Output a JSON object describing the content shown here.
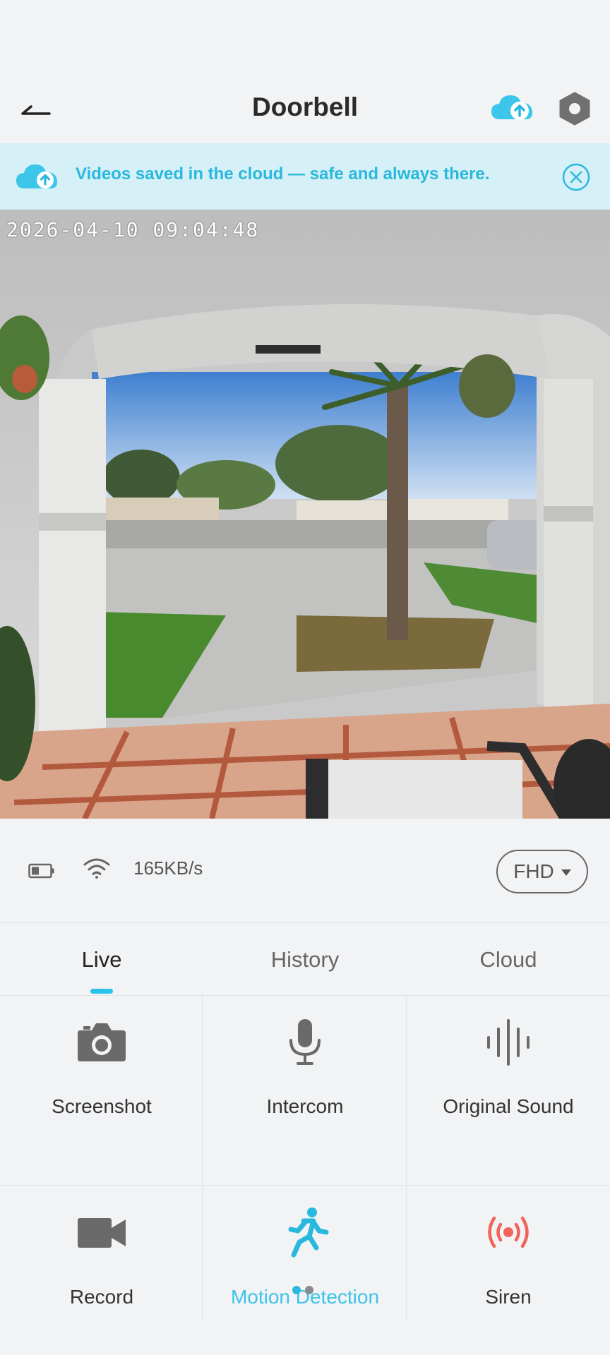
{
  "header": {
    "title": "Doorbell",
    "back_icon": "back-arrow-icon",
    "cloud_icon": "cloud-upload-icon",
    "settings_icon": "hexagon-settings-icon"
  },
  "banner": {
    "text": "Videos saved in the cloud — safe and always there.",
    "icon": "cloud-upload-icon",
    "close_icon": "close-circle-icon"
  },
  "video": {
    "timestamp": "2026-04-10  09:04:48"
  },
  "status": {
    "battery_icon": "battery-icon",
    "wifi_icon": "wifi-icon",
    "speed": "165KB/s",
    "quality": "FHD"
  },
  "tabs": [
    {
      "label": "Live",
      "active": true
    },
    {
      "label": "History",
      "active": false
    },
    {
      "label": "Cloud",
      "active": false
    }
  ],
  "controls": [
    {
      "label": "Screenshot",
      "icon": "camera-icon"
    },
    {
      "label": "Intercom",
      "icon": "microphone-icon"
    },
    {
      "label": "Original Sound",
      "icon": "sound-wave-icon"
    },
    {
      "label": "Record",
      "icon": "video-camera-icon"
    },
    {
      "label": "Motion Detection",
      "icon": "running-person-icon",
      "active": true
    },
    {
      "label": "Siren",
      "icon": "siren-icon"
    }
  ],
  "colors": {
    "accent": "#29b8de",
    "banner_bg": "#d6f0f7",
    "siren": "#f0645a",
    "background": "#f2f3f5"
  }
}
